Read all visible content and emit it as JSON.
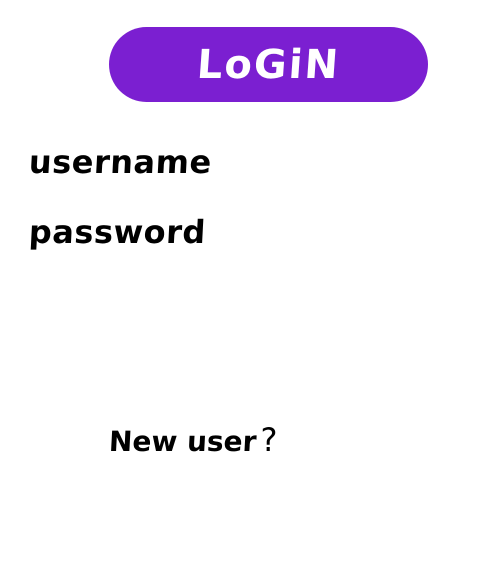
{
  "login": {
    "button_label": "LoGiN"
  },
  "form": {
    "username_label": "username",
    "password_label": "password"
  },
  "footer": {
    "new_user_text": "New user",
    "new_user_suffix": "?"
  },
  "colors": {
    "accent": "#7b1fd1",
    "background": "#ffffff",
    "text": "#000000"
  }
}
